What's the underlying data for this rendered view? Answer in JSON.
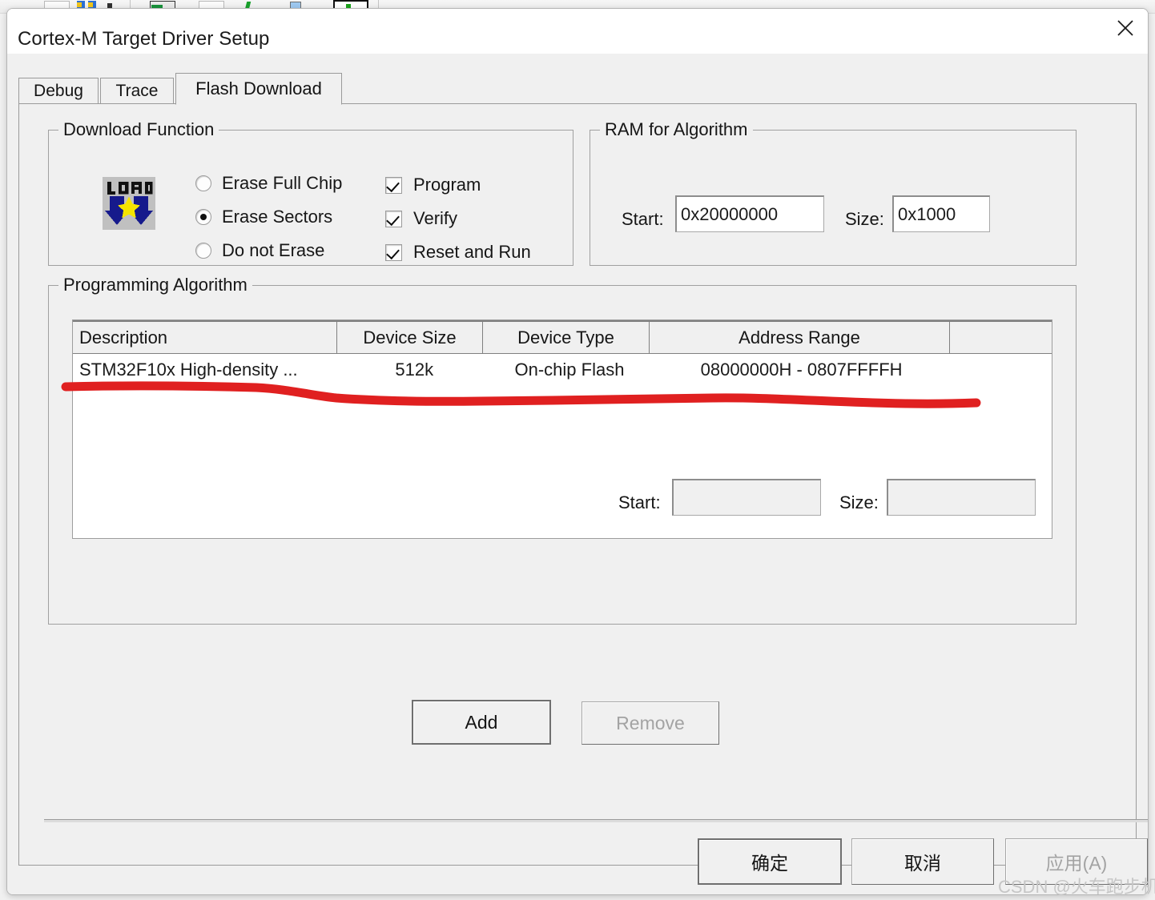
{
  "window": {
    "title": "Cortex-M Target Driver Setup",
    "close_icon": "close-icon"
  },
  "tabs": [
    {
      "label": "Debug",
      "active": false
    },
    {
      "label": "Trace",
      "active": false
    },
    {
      "label": "Flash Download",
      "active": true
    }
  ],
  "download_function": {
    "legend": "Download Function",
    "icon": "load-icon",
    "erase_mode": [
      {
        "label": "Erase Full Chip",
        "selected": false
      },
      {
        "label": "Erase Sectors",
        "selected": true
      },
      {
        "label": "Do not Erase",
        "selected": false
      }
    ],
    "options": [
      {
        "label": "Program",
        "checked": true
      },
      {
        "label": "Verify",
        "checked": true
      },
      {
        "label": "Reset and Run",
        "checked": true
      }
    ]
  },
  "ram_for_algorithm": {
    "legend": "RAM for Algorithm",
    "start_label": "Start:",
    "start_value": "0x20000000",
    "size_label": "Size:",
    "size_value": "0x1000"
  },
  "programming_algorithm": {
    "legend": "Programming Algorithm",
    "columns": [
      "Description",
      "Device Size",
      "Device Type",
      "Address Range",
      ""
    ],
    "rows": [
      {
        "description": "STM32F10x High-density ...",
        "device_size": "512k",
        "device_type": "On-chip Flash",
        "address_range": "08000000H - 0807FFFFH",
        "extra": ""
      }
    ],
    "start_label": "Start:",
    "start_value": "",
    "size_label": "Size:",
    "size_value": ""
  },
  "buttons": {
    "add": "Add",
    "remove": "Remove",
    "ok": "确定",
    "cancel": "取消",
    "apply": "应用(A)"
  },
  "watermark": "CSDN @火车跑步机",
  "colors": {
    "dialog_background": "#f0f0f0",
    "list_background": "#ffffff",
    "annotation_red": "#e02020",
    "text": "#161616",
    "disabled_text": "#a3a3a3",
    "border": "#9a9a9a"
  }
}
